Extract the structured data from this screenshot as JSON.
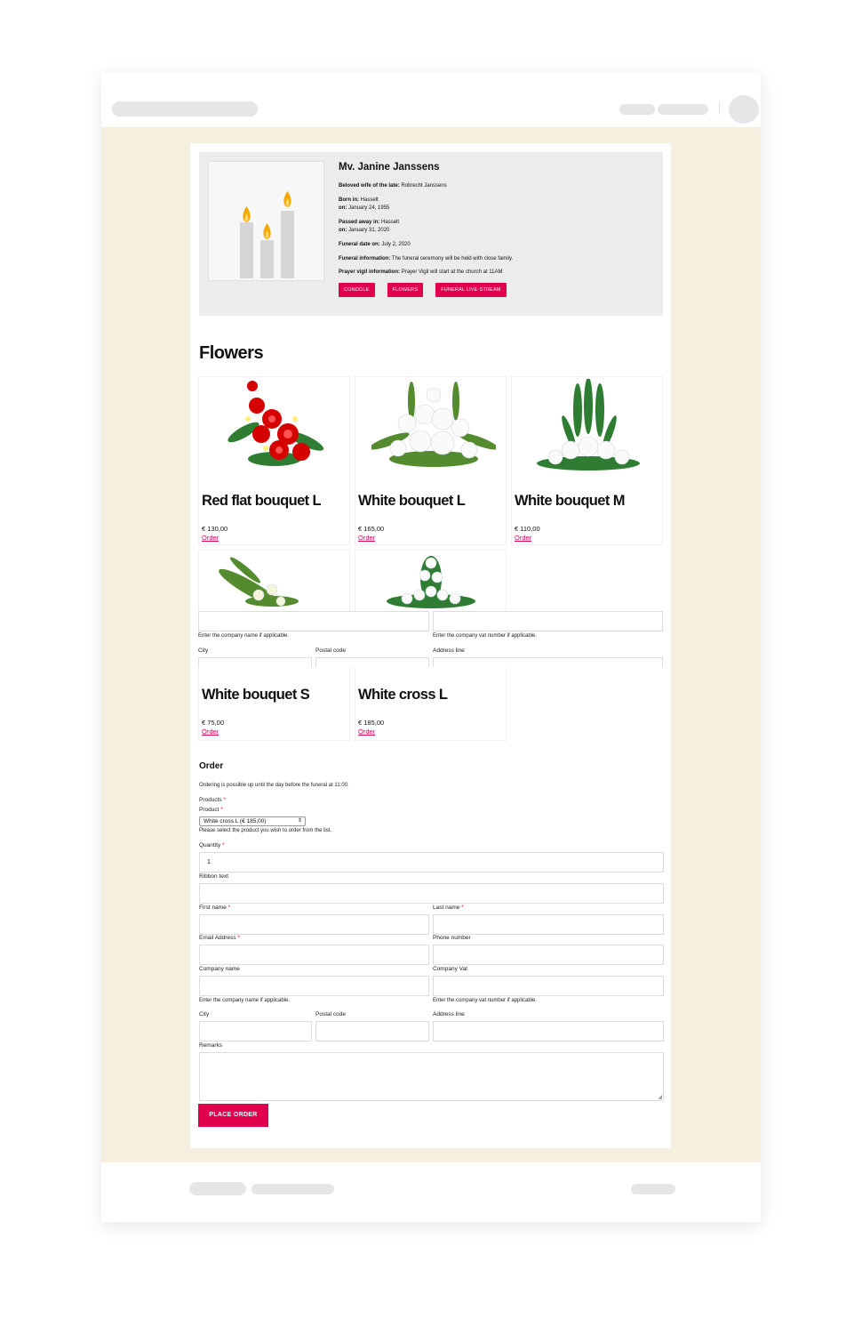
{
  "obituary": {
    "name": "Mv. Janine Janssens",
    "beloved_label": "Beloved wife of the late:",
    "beloved_value": "Robrecht Janssens",
    "born_in_label": "Born in:",
    "born_in_value": "Hasselt",
    "born_on_label": "on:",
    "born_on_value": "January 24, 1955",
    "passed_in_label": "Passed away in:",
    "passed_in_value": "Hasselt",
    "passed_on_label": "on:",
    "passed_on_value": "January 31, 2020",
    "funeral_date_label": "Funeral date on:",
    "funeral_date_value": "July 2, 2020",
    "funeral_info_label": "Funeral information:",
    "funeral_info_value": "The funeral ceremony will be held with close family.",
    "vigil_label": "Prayer vigil information:",
    "vigil_value": "Prayer Vigil will start at the church at 11AM",
    "buttons": [
      "CONDOLE",
      "FLOWERS",
      "FUNERAL LIVE-STREAM"
    ]
  },
  "flowers": {
    "title": "Flowers",
    "order_link": "Order",
    "products": [
      {
        "name": "Red flat bouquet L",
        "price": "€ 130,00"
      },
      {
        "name": "White bouquet L",
        "price": "€ 165,00"
      },
      {
        "name": "White bouquet M",
        "price": "€ 110,00"
      },
      {
        "name": "White bouquet S",
        "price": "€ 75,00"
      },
      {
        "name": "White cross L",
        "price": "€ 185,00"
      }
    ]
  },
  "overlay": {
    "company_hint": "Enter the company name if applicable.",
    "vat_hint": "Enter the company vat number if applicable.",
    "city": "City",
    "postal": "Postal code",
    "address": "Address line"
  },
  "order": {
    "title": "Order",
    "note": "Ordering is possible up until the day before the funeral at 11:00.",
    "products_label": "Products",
    "product_label": "Product",
    "product_selected": "White cross L (€ 185,00)",
    "product_hint": "Please select the product you wish to order from the list.",
    "quantity_label": "Quantity",
    "quantity_value": "1",
    "ribbon_label": "Ribbon text",
    "first_name_label": "First name",
    "last_name_label": "Last name",
    "email_label": "Email Address",
    "phone_label": "Phone number",
    "company_label": "Company name",
    "vat_label": "Company Vat",
    "company_hint": "Enter the company name if applicable.",
    "vat_hint": "Enter the company vat number if applicable.",
    "city_label": "City",
    "postal_label": "Postal code",
    "address_label": "Address line",
    "remarks_label": "Remarks",
    "required_mark": "*",
    "submit": "PLACE ORDER"
  },
  "colors": {
    "accent": "#e0004d",
    "page_bg": "#f5efe0",
    "panel_bg": "#ececec"
  }
}
